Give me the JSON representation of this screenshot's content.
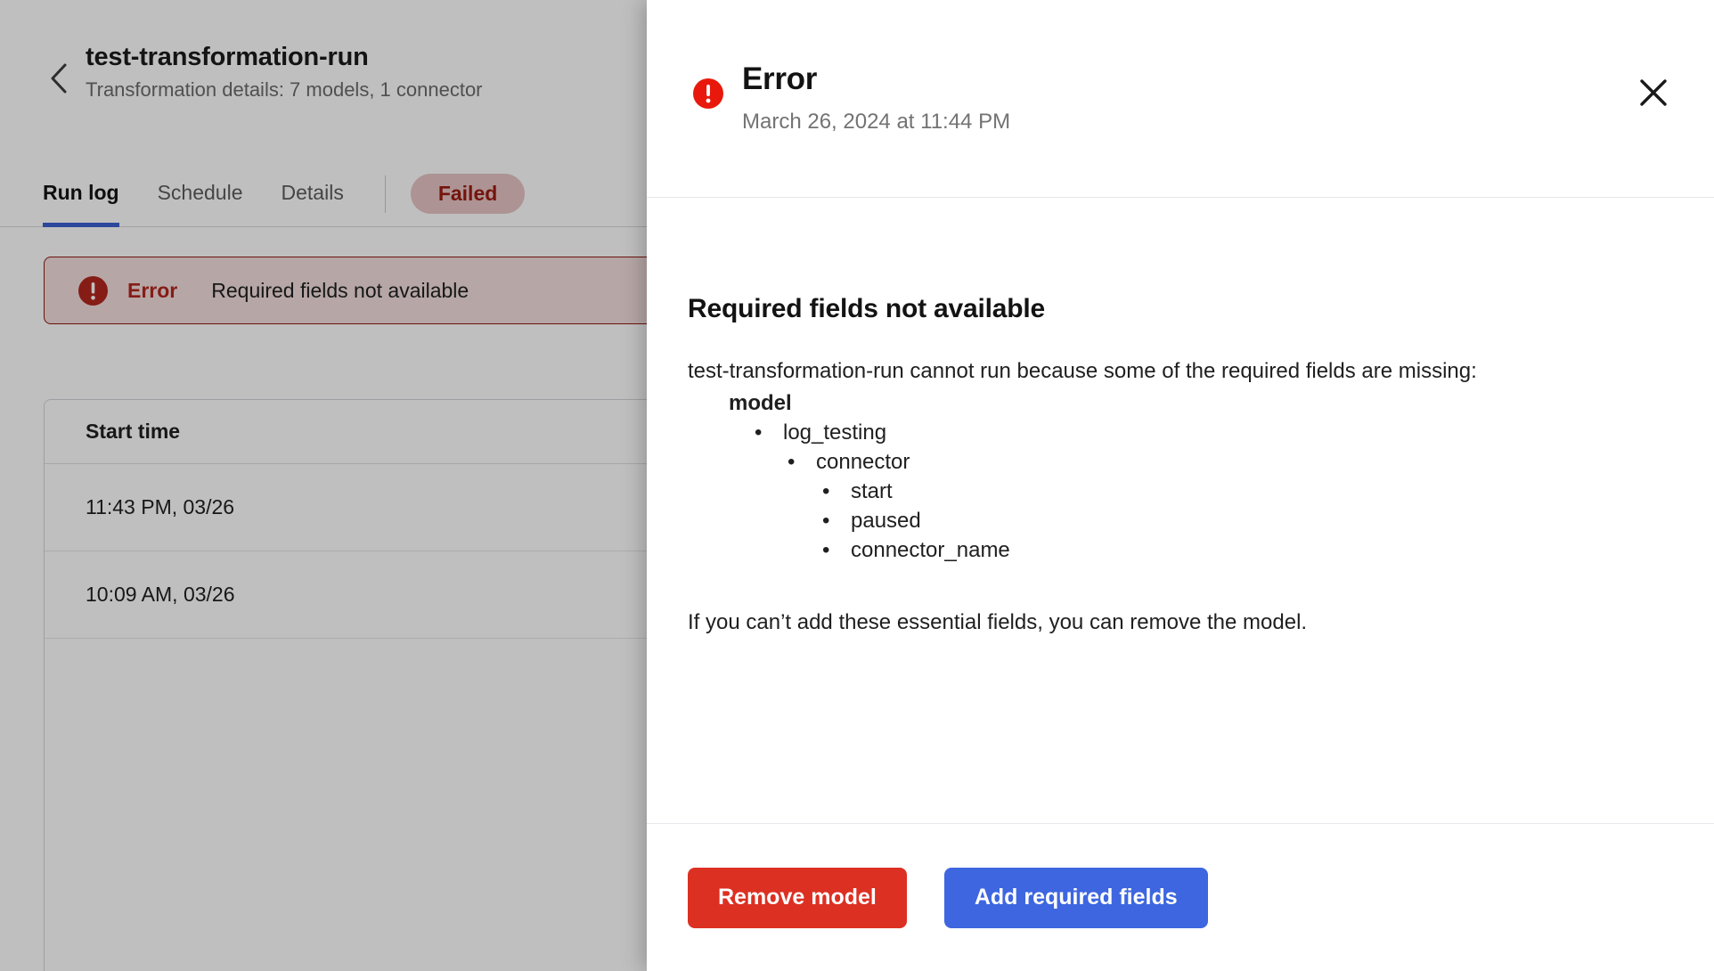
{
  "background": {
    "back_icon": "chevron-left-icon",
    "title": "test-transformation-run",
    "subtitle": "Transformation details: 7 models, 1 connector",
    "tabs": [
      {
        "label": "Run log",
        "active": true
      },
      {
        "label": "Schedule",
        "active": false
      },
      {
        "label": "Details",
        "active": false
      }
    ],
    "status_badge": "Failed",
    "banner": {
      "icon": "error-circle-icon",
      "label": "Error",
      "message": "Required fields not available"
    },
    "table": {
      "columns": [
        "Start time"
      ],
      "rows": [
        {
          "start_time": "11:43 PM, 03/26"
        },
        {
          "start_time": "10:09 AM, 03/26"
        }
      ]
    }
  },
  "modal": {
    "icon": "error-circle-icon",
    "title": "Error",
    "timestamp": "March 26, 2024 at 11:44 PM",
    "close_icon": "close-icon",
    "heading": "Required fields not available",
    "paragraph": "test-transformation-run cannot run because some of the required fields are missing:",
    "tree": {
      "label": "model",
      "items": [
        {
          "text": "log_testing",
          "level": 1
        },
        {
          "text": "connector",
          "level": 2
        },
        {
          "text": "start",
          "level": 3
        },
        {
          "text": "paused",
          "level": 3
        },
        {
          "text": "connector_name",
          "level": 3
        }
      ]
    },
    "outro": "If you can’t add these essential fields, you can remove the model.",
    "buttons": {
      "remove": "Remove model",
      "add": "Add required fields"
    }
  },
  "colors": {
    "danger": "#dc3023",
    "primary": "#3d66e0",
    "tab_underline": "#3b5fd0",
    "badge_bg": "#e7c5c5",
    "badge_text": "#9b1b12",
    "banner_bg": "#f3dede",
    "banner_border": "#8f1a12"
  }
}
